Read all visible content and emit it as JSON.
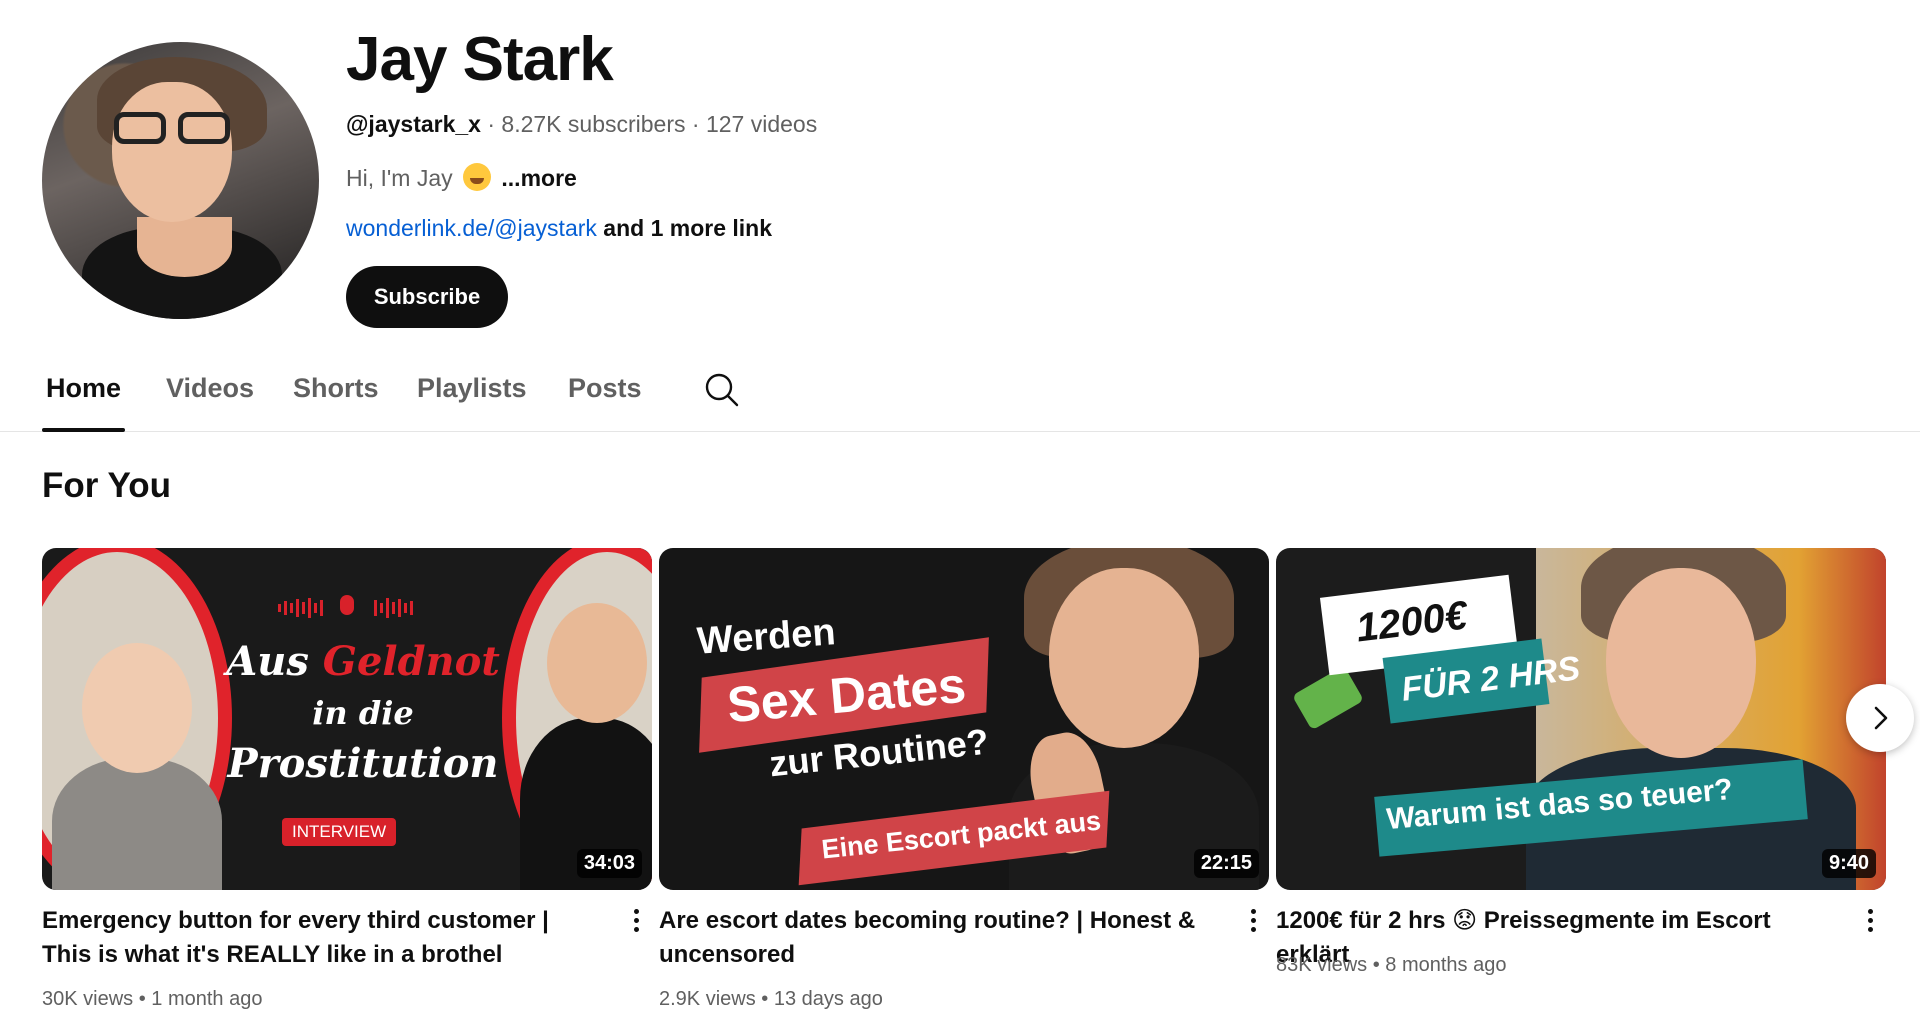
{
  "channel": {
    "name": "Jay Stark",
    "handle": "@jaystark_x",
    "subscribers": "8.27K subscribers",
    "videos_count": "127 videos",
    "separator": " · ",
    "bio": "Hi, I'm Jay",
    "bio_more": "...more",
    "link": "wonderlink.de/@jaystark",
    "link_more": "and 1 more link",
    "subscribe_label": "Subscribe"
  },
  "tabs": [
    {
      "label": "Home",
      "active": true
    },
    {
      "label": "Videos"
    },
    {
      "label": "Shorts"
    },
    {
      "label": "Playlists"
    },
    {
      "label": "Posts"
    }
  ],
  "section": {
    "title": "For You"
  },
  "videos": [
    {
      "title": "Emergency button for every third customer | This is what it's REALLY like in a brothel",
      "duration": "34:03",
      "views": "30K views",
      "age": "1 month ago",
      "thumb_text": {
        "aus": "Aus",
        "geldnot": "Geldnot",
        "in_die": "in die",
        "prostitution": "Prostitution",
        "badge": "INTERVIEW"
      }
    },
    {
      "title": "Are escort dates becoming routine? | Honest & uncensored",
      "duration": "22:15",
      "views": "2.9K views",
      "age": "13 days ago",
      "thumb_text": {
        "l1": "Werden",
        "l2": "Sex Dates",
        "l3": "zur Routine?",
        "l4": "Eine Escort packt aus"
      }
    },
    {
      "title": "1200€ für 2 hrs 😟 Preissegmente im Escort erklärt",
      "duration": "9:40",
      "views": "83K views",
      "age": "8 months ago",
      "thumb_text": {
        "l1": "1200€",
        "l2": "FÜR 2 HRS",
        "l3": "Warum ist das so teuer?"
      }
    }
  ],
  "stats_separator": " • ",
  "colors": {
    "accent_link": "#065fd4",
    "subscribe_bg": "#0f0f0f",
    "text_secondary": "#606060",
    "thumb_red": "#e0232b",
    "thumb_teal": "#1e8a8a"
  },
  "icons": {
    "search": "search-icon",
    "more": "more-vert-icon",
    "next": "chevron-right-icon"
  }
}
